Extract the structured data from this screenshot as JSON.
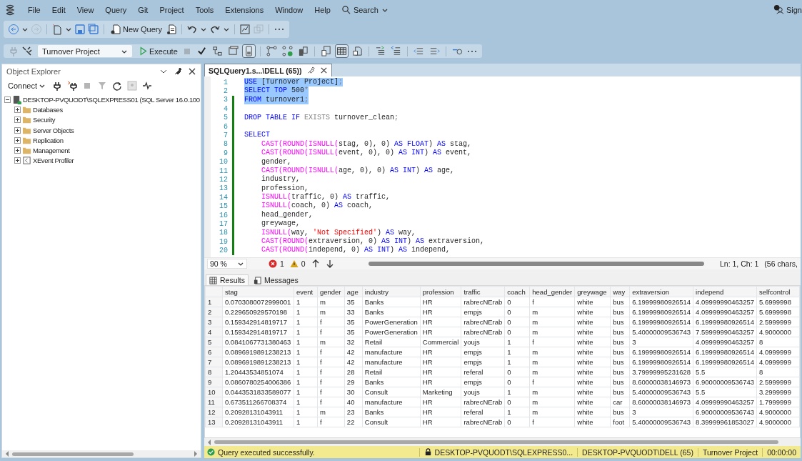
{
  "menu_bar": {
    "items": [
      "File",
      "Edit",
      "View",
      "Query",
      "Git",
      "Project",
      "Tools",
      "Extensions",
      "Window",
      "Help"
    ],
    "search": "Search",
    "account": "Sign"
  },
  "toolbar_1": {
    "new_query": "New Query"
  },
  "toolbar_2": {
    "database": "Turnover Project",
    "execute": "Execute",
    "toggles": [
      {
        "selected": false
      },
      {
        "selected": false
      },
      {
        "selected": true
      },
      {
        "selected": false
      },
      {
        "selected": false
      },
      {
        "selected": false
      },
      {
        "selected": true
      },
      {
        "selected": false
      },
      {
        "selected": false
      },
      {
        "selected": false
      },
      {
        "selected": false
      },
      {
        "selected": false
      },
      {
        "selected": false
      }
    ]
  },
  "object_explorer": {
    "title": "Object Explorer",
    "connect": "Connect",
    "tree": [
      {
        "label": "DESKTOP-PVQUODT\\SQLEXPRESS01 (SQL Server 16.0.100",
        "kind": "server",
        "expanded": true,
        "children": [
          {
            "label": "Databases",
            "kind": "folder",
            "expanded": false
          },
          {
            "label": "Security",
            "kind": "folder",
            "expanded": false
          },
          {
            "label": "Server Objects",
            "kind": "folder",
            "expanded": false
          },
          {
            "label": "Replication",
            "kind": "folder",
            "expanded": false
          },
          {
            "label": "Management",
            "kind": "folder",
            "expanded": false
          },
          {
            "label": "XEvent Profiler",
            "kind": "profiler",
            "expanded": false
          }
        ]
      }
    ]
  },
  "editor": {
    "tabs": [
      {
        "label": "SQLQuery1.s...\\DELL (65))",
        "selected": true
      }
    ],
    "lines": [
      {
        "number": "1",
        "selected": true,
        "changed": false,
        "tokens": [
          {
            "kind": "kw",
            "text": "USE"
          },
          {
            "kind": "txt",
            "text": " [Turnover Project]"
          },
          {
            "kind": "punct",
            "text": ";"
          }
        ]
      },
      {
        "number": "2",
        "selected": true,
        "changed": false,
        "tokens": [
          {
            "kind": "kw",
            "text": "SELECT TOP "
          },
          {
            "kind": "txt",
            "text": "500"
          },
          {
            "kind": "punct",
            "text": "*"
          }
        ]
      },
      {
        "number": "3",
        "selected": true,
        "changed": true,
        "tokens": [
          {
            "kind": "kw",
            "text": "FROM"
          },
          {
            "kind": "txt",
            "text": " turnover1"
          },
          {
            "kind": "punct",
            "text": ";"
          }
        ]
      },
      {
        "number": "4",
        "selected": false,
        "changed": true
      },
      {
        "number": "5",
        "selected": false,
        "changed": true,
        "tokens": [
          {
            "kind": "kw",
            "text": "DROP TABLE IF "
          },
          {
            "kind": "punct",
            "text": "EXISTS"
          },
          {
            "kind": "txt",
            "text": " turnover_clean"
          },
          {
            "kind": "punct",
            "text": ";"
          }
        ]
      },
      {
        "number": "6",
        "selected": false,
        "changed": true
      },
      {
        "number": "7",
        "selected": false,
        "changed": true,
        "tokens": [
          {
            "kind": "kw",
            "text": "SELECT"
          }
        ]
      },
      {
        "number": "8",
        "selected": false,
        "changed": true,
        "tokens": [
          {
            "kind": "fn",
            "text": "    CAST(ROUND(ISNULL("
          },
          {
            "kind": "txt",
            "text": "stag, 0), 0) "
          },
          {
            "kind": "kw",
            "text": "AS FLOAT"
          },
          {
            "kind": "txt",
            "text": ") "
          },
          {
            "kind": "kw",
            "text": "AS"
          },
          {
            "kind": "txt",
            "text": " stag,"
          }
        ]
      },
      {
        "number": "9",
        "selected": false,
        "changed": true,
        "tokens": [
          {
            "kind": "fn",
            "text": "    CAST(ROUND(ISNULL("
          },
          {
            "kind": "txt",
            "text": "event, 0), 0) "
          },
          {
            "kind": "kw",
            "text": "AS INT"
          },
          {
            "kind": "txt",
            "text": ") "
          },
          {
            "kind": "kw",
            "text": "AS"
          },
          {
            "kind": "txt",
            "text": " event,"
          }
        ]
      },
      {
        "number": "10",
        "selected": false,
        "changed": true,
        "tokens": [
          {
            "kind": "txt",
            "text": "    gender,"
          }
        ]
      },
      {
        "number": "11",
        "selected": false,
        "changed": true,
        "tokens": [
          {
            "kind": "fn",
            "text": "    CAST(ROUND(ISNULL("
          },
          {
            "kind": "txt",
            "text": "age, 0), 0) "
          },
          {
            "kind": "kw",
            "text": "AS INT"
          },
          {
            "kind": "txt",
            "text": ") "
          },
          {
            "kind": "kw",
            "text": "AS"
          },
          {
            "kind": "txt",
            "text": " age,"
          }
        ]
      },
      {
        "number": "12",
        "selected": false,
        "changed": true,
        "tokens": [
          {
            "kind": "txt",
            "text": "    industry,"
          }
        ]
      },
      {
        "number": "13",
        "selected": false,
        "changed": true,
        "tokens": [
          {
            "kind": "txt",
            "text": "    profession,"
          }
        ]
      },
      {
        "number": "14",
        "selected": false,
        "changed": true,
        "tokens": [
          {
            "kind": "fn",
            "text": "    ISNULL("
          },
          {
            "kind": "txt",
            "text": "traffic, 0) "
          },
          {
            "kind": "kw",
            "text": "AS"
          },
          {
            "kind": "txt",
            "text": " traffic,"
          }
        ]
      },
      {
        "number": "15",
        "selected": false,
        "changed": true,
        "tokens": [
          {
            "kind": "fn",
            "text": "    ISNULL("
          },
          {
            "kind": "txt",
            "text": "coach, 0) "
          },
          {
            "kind": "kw",
            "text": "AS"
          },
          {
            "kind": "txt",
            "text": " coach,"
          }
        ]
      },
      {
        "number": "16",
        "selected": false,
        "changed": true,
        "tokens": [
          {
            "kind": "txt",
            "text": "    head_gender,"
          }
        ]
      },
      {
        "number": "17",
        "selected": false,
        "changed": true,
        "tokens": [
          {
            "kind": "txt",
            "text": "    greywage,"
          }
        ]
      },
      {
        "number": "18",
        "selected": false,
        "changed": true,
        "tokens": [
          {
            "kind": "fn",
            "text": "    ISNULL("
          },
          {
            "kind": "txt",
            "text": "way, "
          },
          {
            "kind": "str",
            "text": "'Not Specified'"
          },
          {
            "kind": "txt",
            "text": ") "
          },
          {
            "kind": "kw",
            "text": "AS"
          },
          {
            "kind": "txt",
            "text": " way,"
          }
        ]
      },
      {
        "number": "19",
        "selected": false,
        "changed": true,
        "tokens": [
          {
            "kind": "fn",
            "text": "    CAST(ROUND("
          },
          {
            "kind": "txt",
            "text": "extraversion, 0) "
          },
          {
            "kind": "kw",
            "text": "AS INT"
          },
          {
            "kind": "txt",
            "text": ") "
          },
          {
            "kind": "kw",
            "text": "AS"
          },
          {
            "kind": "txt",
            "text": " extraversion,"
          }
        ]
      },
      {
        "number": "20",
        "selected": false,
        "changed": true,
        "tokens": [
          {
            "kind": "fn",
            "text": "    CAST(ROUND("
          },
          {
            "kind": "txt",
            "text": "independ, 0) "
          },
          {
            "kind": "kw",
            "text": "AS INT"
          },
          {
            "kind": "txt",
            "text": ") "
          },
          {
            "kind": "kw",
            "text": "AS"
          },
          {
            "kind": "txt",
            "text": " independ,"
          }
        ]
      }
    ],
    "zoom": "90 %",
    "errors": "1",
    "warnings": "0",
    "position": "Ln: 1, Ch: 1",
    "chars": "(56 chars,"
  },
  "results": {
    "tabs": [
      {
        "label": "Results",
        "selected": true
      },
      {
        "label": "Messages",
        "selected": false
      }
    ],
    "columns": [
      "",
      "stag",
      "event",
      "gender",
      "age",
      "industry",
      "profession",
      "traffic",
      "coach",
      "head_gender",
      "greywage",
      "way",
      "extraversion",
      "independ",
      "selfcontrol"
    ],
    "rows": [
      [
        "1",
        "0.0703080072999001",
        "1",
        "m",
        "35",
        "Banks",
        "HR",
        "rabrecNErab",
        "0",
        "f",
        "white",
        "bus",
        "6.19999980926514",
        "4.09999990463257",
        "5.6999998"
      ],
      [
        "2",
        "0.229650929570198",
        "1",
        "m",
        "33",
        "Banks",
        "HR",
        "empjs",
        "0",
        "m",
        "white",
        "bus",
        "6.19999980926514",
        "4.09999990463257",
        "5.6999998"
      ],
      [
        "3",
        "0.159342914819717",
        "1",
        "f",
        "35",
        "PowerGeneration",
        "HR",
        "rabrecNErab",
        "0",
        "m",
        "white",
        "bus",
        "6.19999980926514",
        "6.19999980926514",
        "2.5999999"
      ],
      [
        "4",
        "0.159342914819717",
        "1",
        "f",
        "35",
        "PowerGeneration",
        "HR",
        "rabrecNErab",
        "0",
        "m",
        "white",
        "bus",
        "5.40000009536743",
        "7.59999990463257",
        "4.9000000"
      ],
      [
        "5",
        "0.0841067731380463",
        "1",
        "m",
        "32",
        "Retail",
        "Commercial",
        "youjs",
        "1",
        "f",
        "white",
        "bus",
        "3",
        "4.09999990463257",
        "8"
      ],
      [
        "6",
        "0.0896919891238213",
        "1",
        "f",
        "42",
        "manufacture",
        "HR",
        "empjs",
        "1",
        "m",
        "white",
        "bus",
        "6.19999980926514",
        "6.19999980926514",
        "4.0999999"
      ],
      [
        "7",
        "0.0896919891238213",
        "1",
        "f",
        "42",
        "manufacture",
        "HR",
        "empjs",
        "1",
        "m",
        "white",
        "bus",
        "6.19999980926514",
        "6.19999980926514",
        "4.0999999"
      ],
      [
        "8",
        "1.20443534851074",
        "1",
        "f",
        "28",
        "Retail",
        "HR",
        "referal",
        "0",
        "m",
        "white",
        "bus",
        "3.79999995231628",
        "5.5",
        "8"
      ],
      [
        "9",
        "0.0860780254006386",
        "1",
        "f",
        "29",
        "Banks",
        "HR",
        "empjs",
        "0",
        "f",
        "white",
        "bus",
        "8.60000038146973",
        "6.90000009536743",
        "2.5999999"
      ],
      [
        "10",
        "0.0443531833589077",
        "1",
        "f",
        "30",
        "Consult",
        "Marketing",
        "youjs",
        "1",
        "m",
        "white",
        "bus",
        "5.40000009536743",
        "5.5",
        "3.2999999"
      ],
      [
        "11",
        "0.673511266708374",
        "1",
        "f",
        "40",
        "manufacture",
        "HR",
        "rabrecNErab",
        "0",
        "m",
        "white",
        "car",
        "8.60000038146973",
        "4.09999990463257",
        "1.7999999"
      ],
      [
        "12",
        "0.20928131043911",
        "1",
        "m",
        "23",
        "Banks",
        "HR",
        "referal",
        "1",
        "m",
        "white",
        "bus",
        "3",
        "6.90000009536743",
        "4.9000000"
      ],
      [
        "13",
        "0.20928131043911",
        "1",
        "f",
        "22",
        "Consult",
        "HR",
        "rabrecNErab",
        "0",
        "f",
        "white",
        "foot",
        "5.40000009536743",
        "8.39999961853027",
        "4.9000000"
      ]
    ]
  },
  "status_bar": {
    "message": "Query executed successfully.",
    "server": "DESKTOP-PVQUODT\\SQLEXPRESS0...",
    "user": "DESKTOP-PVQUODT\\DELL (65)",
    "database": "Turnover Project",
    "elapsed": "00:00:00"
  }
}
